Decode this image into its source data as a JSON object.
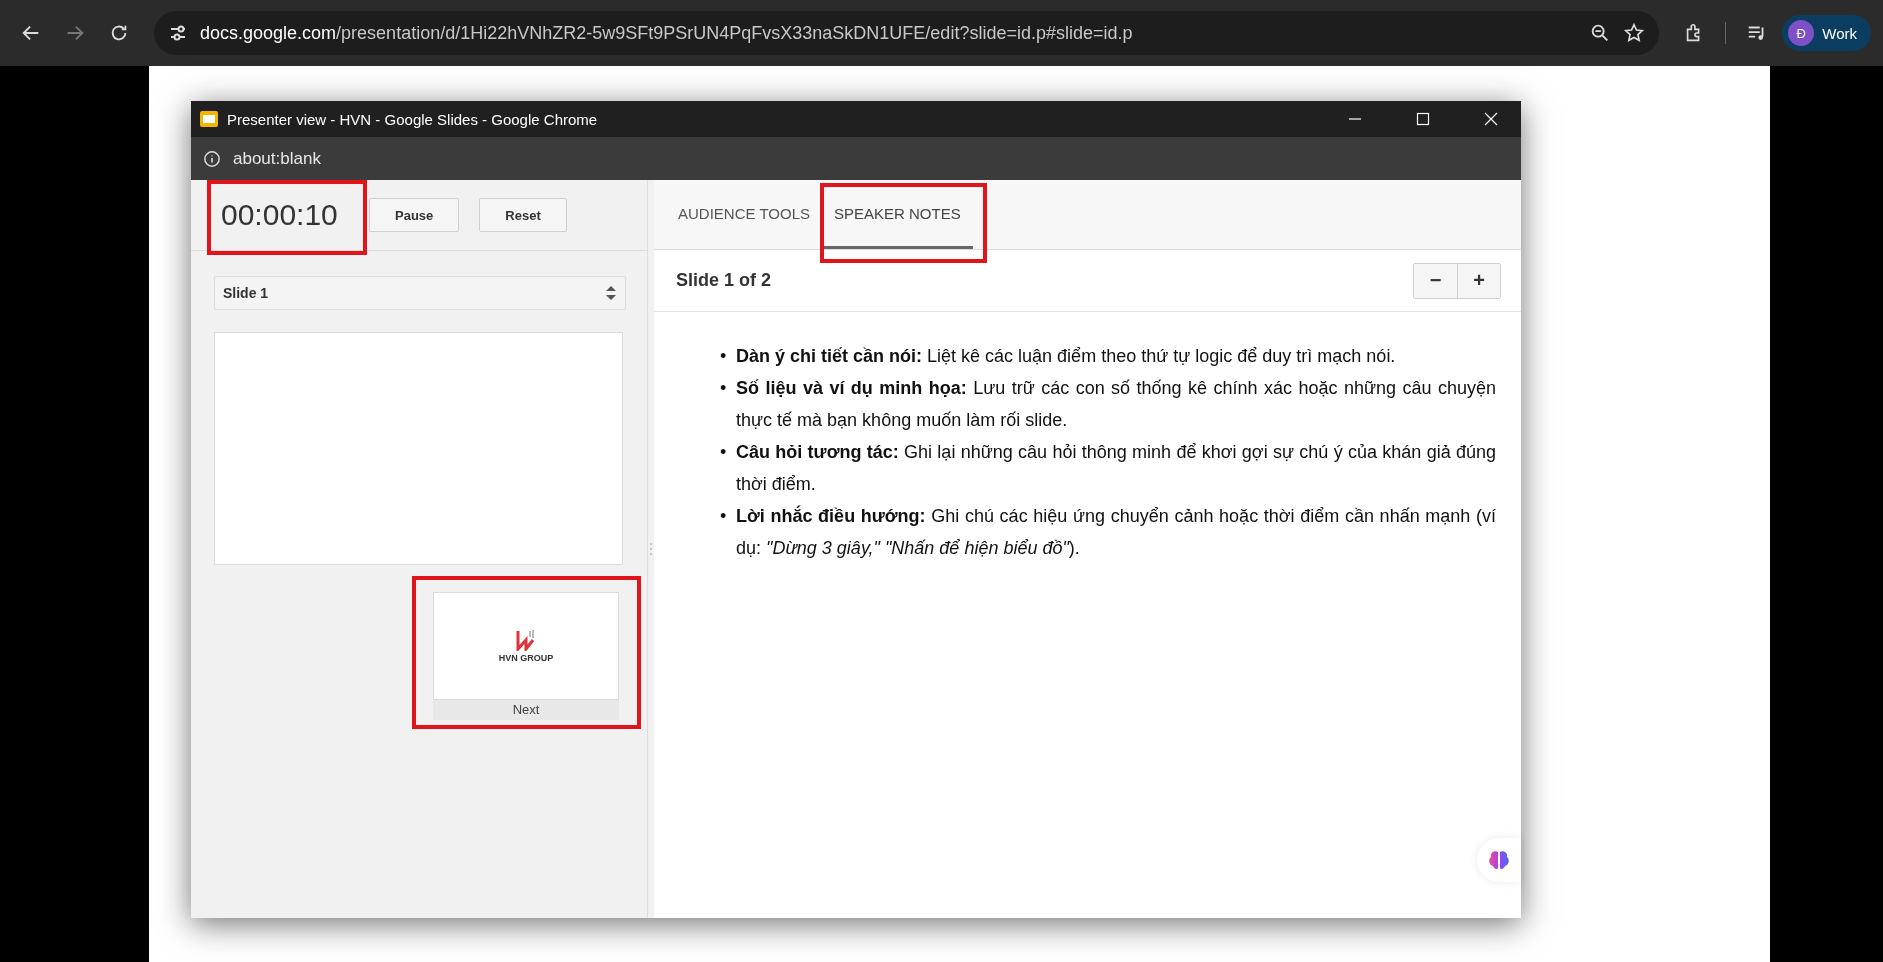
{
  "browser": {
    "url_host": "docs.google.com",
    "url_path": "/presentation/d/1Hi22hVNhZR2-5w9SFt9PSrUN4PqFvsX33naSkDN1UFE/edit?slide=id.p#slide=id.p",
    "profile": {
      "initial": "Đ",
      "label": "Work"
    }
  },
  "popup": {
    "title": "Presenter view - HVN - Google Slides - Google Chrome",
    "address": "about:blank",
    "timer": "00:00:10",
    "timer_buttons": [
      "Pause",
      "Reset"
    ],
    "slide_select": "Slide 1",
    "next_slide": {
      "logo_text": "HVN GROUP",
      "label": "Next"
    },
    "tabs": [
      {
        "label": "AUDIENCE TOOLS",
        "selected": false
      },
      {
        "label": "SPEAKER NOTES",
        "selected": true
      }
    ],
    "notes_header": "Slide 1 of 2",
    "zoom_buttons": [
      "−",
      "+"
    ],
    "notes": [
      {
        "marker": "•",
        "text": "**Dàn ý chi tiết cần nói:** Liệt kê các luận điểm theo thứ tự logic để duy trì mạch nói."
      },
      {
        "marker": "•",
        "text": "**Số liệu và ví dụ minh họa:** Lưu trữ các con số thống kê chính xác hoặc những câu chuyện thực tế mà bạn không muốn làm rối slide."
      },
      {
        "marker": "•",
        "text": "**Câu hỏi tương tác:** Ghi lại những câu hỏi thông minh để khơi gợi sự chú ý của khán giả đúng thời điểm."
      },
      {
        "marker": "•",
        "text": "**Lời nhắc điều hướng:** Ghi chú các hiệu ứng chuyển cảnh hoặc thời điểm cần nhấn mạnh (ví dụ: *\"Dừng 3 giây,\" \"Nhấn để hiện biểu đồ\"*)."
      }
    ]
  }
}
